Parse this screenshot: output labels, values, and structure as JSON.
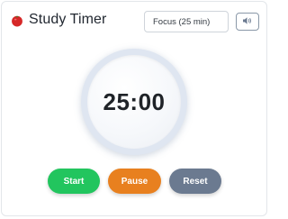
{
  "app": {
    "title": "Study Timer"
  },
  "mode_select": {
    "selected": "Focus (25 min)"
  },
  "sound_toggle": {
    "icon": "speaker-icon"
  },
  "timer": {
    "display": "25:00"
  },
  "controls": {
    "start_label": "Start",
    "pause_label": "Pause",
    "reset_label": "Reset"
  },
  "colors": {
    "start": "#22c55e",
    "pause": "#e8801f",
    "reset": "#6b7a90",
    "tomato": "#d62828"
  }
}
